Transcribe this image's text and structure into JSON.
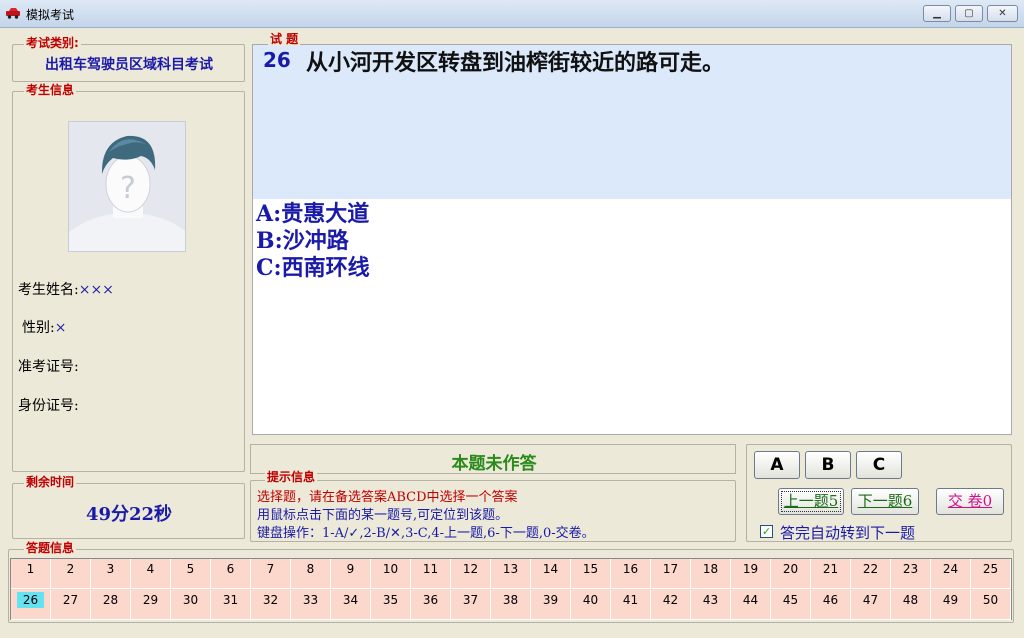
{
  "window": {
    "title": "模拟考试",
    "minimize_label": "▁",
    "maximize_label": "▢",
    "close_label": "✕"
  },
  "exam_type": {
    "legend": "考试类别:",
    "value": "出租车驾驶员区域科目考试"
  },
  "candidate": {
    "legend": "考生信息",
    "name_label": "考生姓名:",
    "name_value": "×××",
    "gender_label": "性别:",
    "gender_value": "×",
    "admission_label": "准考证号:",
    "id_label": "身份证号:"
  },
  "timer": {
    "legend": "剩余时间",
    "value": "49分22秒"
  },
  "question": {
    "legend": "试  题",
    "number": "26",
    "text": "从小河开发区转盘到油榨街较近的路可走。",
    "options": [
      "A:贵惠大道",
      "B:沙冲路",
      "C:西南环线"
    ]
  },
  "status": {
    "text": "本题未作答"
  },
  "hint": {
    "legend": "提示信息",
    "lines": [
      "选择题，请在备选答案ABCD中选择一个答案",
      "用鼠标点击下面的某一题号,可定位到该题。",
      "键盘操作：1-A/✓,2-B/✕,3-C,4-上一题,6-下一题,0-交卷。"
    ],
    "line_colors": [
      "#c00000",
      "#1a1aa8",
      "#1a1aa8"
    ]
  },
  "answer_buttons": [
    "A",
    "B",
    "C"
  ],
  "nav": {
    "prev_label": "上一题5",
    "next_label": "下一题6",
    "submit_label": "交 卷0"
  },
  "auto_next": {
    "checked": true,
    "label": "答完自动转到下一题"
  },
  "answer_grid": {
    "legend": "答题信息",
    "current": 26,
    "rows": [
      [
        "1",
        "2",
        "3",
        "4",
        "5",
        "6",
        "7",
        "8",
        "9",
        "10",
        "11",
        "12",
        "13",
        "14",
        "15",
        "16",
        "17",
        "18",
        "19",
        "20",
        "21",
        "22",
        "23",
        "24",
        "25"
      ],
      [
        "26",
        "27",
        "28",
        "29",
        "30",
        "31",
        "32",
        "33",
        "34",
        "35",
        "36",
        "37",
        "38",
        "39",
        "40",
        "41",
        "42",
        "43",
        "44",
        "45",
        "46",
        "47",
        "48",
        "49",
        "50"
      ]
    ]
  },
  "icons": {
    "app": "car-icon",
    "avatar": "person-placeholder-icon",
    "checkbox": "check-icon"
  }
}
